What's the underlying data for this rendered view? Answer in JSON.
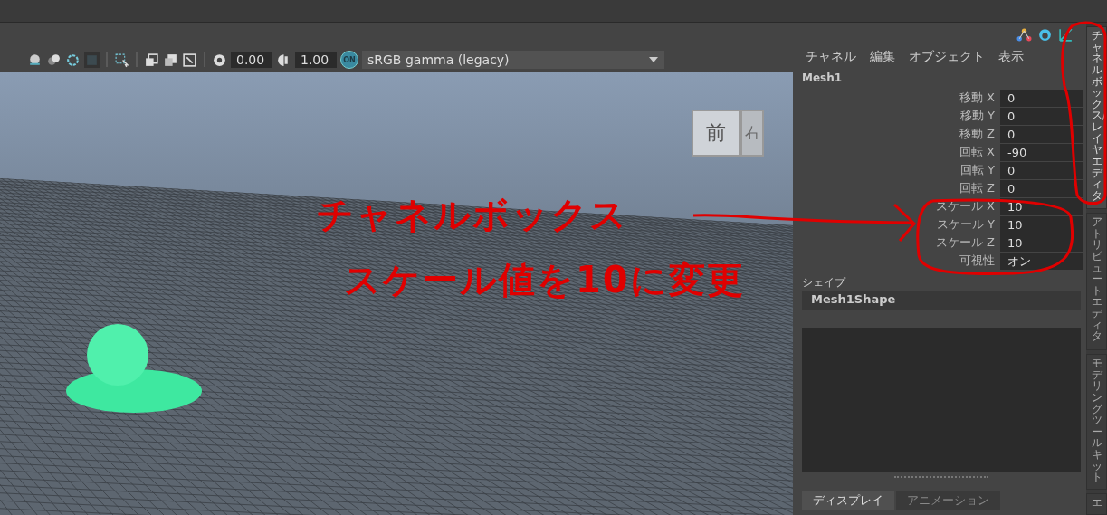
{
  "toolbar": {
    "exposure": "0.00",
    "gamma": "1.00",
    "view_transform_badge": "ON",
    "color_space": "sRGB gamma (legacy)"
  },
  "view_cube": {
    "front": "前",
    "right": "右"
  },
  "channel_box": {
    "menus": [
      "チャネル",
      "編集",
      "オブジェクト",
      "表示"
    ],
    "object": "Mesh1",
    "channels": [
      {
        "label": "移動 X",
        "value": "0"
      },
      {
        "label": "移動 Y",
        "value": "0"
      },
      {
        "label": "移動 Z",
        "value": "0"
      },
      {
        "label": "回転 X",
        "value": "-90"
      },
      {
        "label": "回転 Y",
        "value": "0"
      },
      {
        "label": "回転 Z",
        "value": "0"
      },
      {
        "label": "スケール X",
        "value": "10"
      },
      {
        "label": "スケール Y",
        "value": "10"
      },
      {
        "label": "スケール Z",
        "value": "10"
      },
      {
        "label": "可視性",
        "value": "オン"
      }
    ],
    "shapes_header": "シェイプ",
    "shape": "Mesh1Shape",
    "tabs": [
      {
        "label": "ディスプレイ",
        "selected": true
      },
      {
        "label": "アニメーション",
        "selected": false
      }
    ]
  },
  "side_tabs": [
    {
      "label": "チャネルボックス/レイヤエディタ",
      "selected": true
    },
    {
      "label": "アトリビュートエディタ",
      "selected": false
    },
    {
      "label": "モデリングツールキット",
      "selected": false
    },
    {
      "label": "エ",
      "selected": false
    }
  ],
  "annotations": [
    {
      "text": "チャネルボックス"
    },
    {
      "text": "スケール値を10に変更"
    }
  ]
}
